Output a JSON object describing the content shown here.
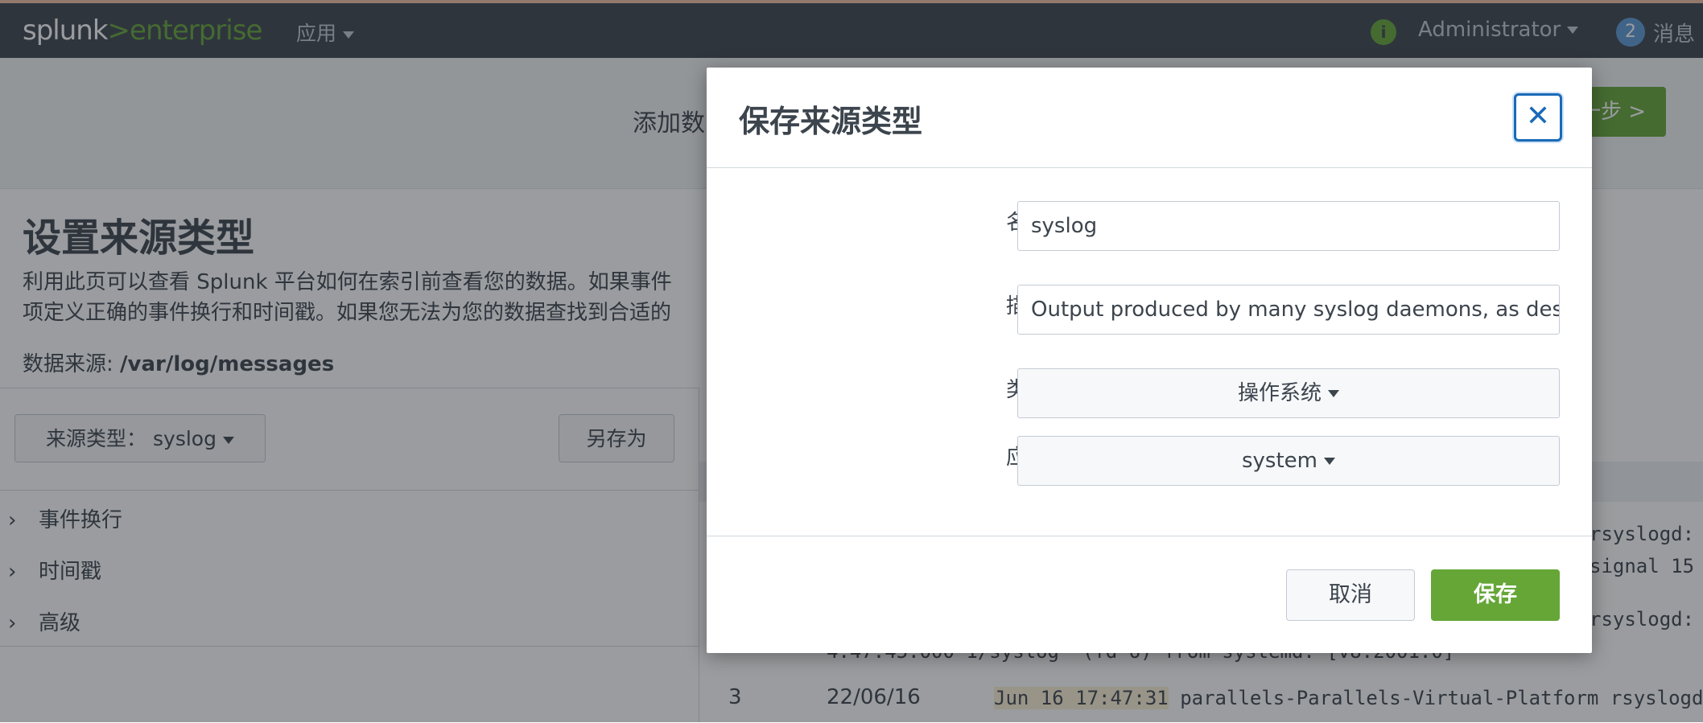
{
  "topbar": {
    "logo_splunk": "splunk",
    "logo_gt": ">",
    "logo_enterprise": "enterprise",
    "apps_menu": "应用",
    "info_icon": "info-icon",
    "user_menu": "Administrator",
    "messages_count": "2",
    "messages_label": "消息"
  },
  "subheader": {
    "wizard_title": "添加数",
    "next_button": "一步 >"
  },
  "page": {
    "title": "设置来源类型",
    "description_line1": "利用此页可以查看 Splunk 平台如何在索引前查看您的数据。如果事件",
    "description_line2": "项定义正确的事件换行和时间戳。如果您无法为您的数据查找到合适的",
    "datasource_label": "数据来源: ",
    "datasource_value": "/var/log/messages"
  },
  "left_panel": {
    "sourcetype_button": "来源类型： syslog",
    "save_as_button": "另存为",
    "sections": [
      {
        "label": "事件换行"
      },
      {
        "label": "时间戳"
      },
      {
        "label": "高级"
      }
    ]
  },
  "events": [
    {
      "line1": "rsyslogd:",
      "line2": " signal 15"
    },
    {
      "line1": "rsyslogd:",
      "line2": "4.47.45.000   1/syslog\" (fd 6) from systemd.  [v8.2001.0]"
    },
    {
      "num": "3",
      "date": "22/06/16",
      "timestamp": "Jun 16 17:47:31",
      "text": " parallels-Parallels-Virtual-Platform rsyslogd:"
    }
  ],
  "modal": {
    "title": "保存来源类型",
    "close_icon": "close-icon",
    "name_label": "名称",
    "name_value": "syslog",
    "description_label": "描述",
    "description_value": "Output produced by many syslog daemons, as descr",
    "category_label": "类别",
    "category_value": "操作系统",
    "app_label": "应用",
    "app_value": "system",
    "cancel_button": "取消",
    "save_button": "保存"
  },
  "colors": {
    "topbar": "#3c444d",
    "accent_green": "#65a637",
    "focus_blue": "#1a6ab7"
  }
}
